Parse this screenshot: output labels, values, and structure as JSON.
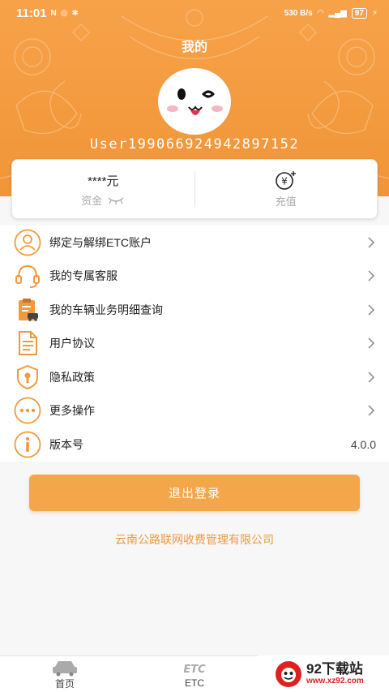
{
  "status_bar": {
    "time": "11:01",
    "net_speed": "530 B/s",
    "battery": "97"
  },
  "header": {
    "title": "我的",
    "username": "User19906692494289715​2"
  },
  "balance": {
    "amount": "****元",
    "amount_label": "资金",
    "recharge_label": "充值"
  },
  "menu": {
    "items": [
      {
        "label": "绑定与解绑ETC账户",
        "icon": "user-icon"
      },
      {
        "label": "我的专属客服",
        "icon": "headset-icon"
      },
      {
        "label": "我的车辆业务明细查询",
        "icon": "clipboard-car-icon"
      },
      {
        "label": "用户协议",
        "icon": "document-icon"
      },
      {
        "label": "隐私政策",
        "icon": "shield-lock-icon"
      },
      {
        "label": "更多操作",
        "icon": "more-icon"
      },
      {
        "label": "版本号",
        "icon": "info-icon"
      }
    ],
    "version": "4.0.0"
  },
  "logout_label": "退出登录",
  "company": "云南公路联网收费管理有限公司",
  "tabs": [
    {
      "label": "首页",
      "icon": "car-icon"
    },
    {
      "label": "ETC",
      "icon": "etc-icon"
    }
  ],
  "watermark": {
    "site": "92下载站",
    "url": "www.xz92.com"
  },
  "colors": {
    "accent": "#f39a3e",
    "button": "#f4a64a",
    "company_text": "#f09a3e"
  }
}
